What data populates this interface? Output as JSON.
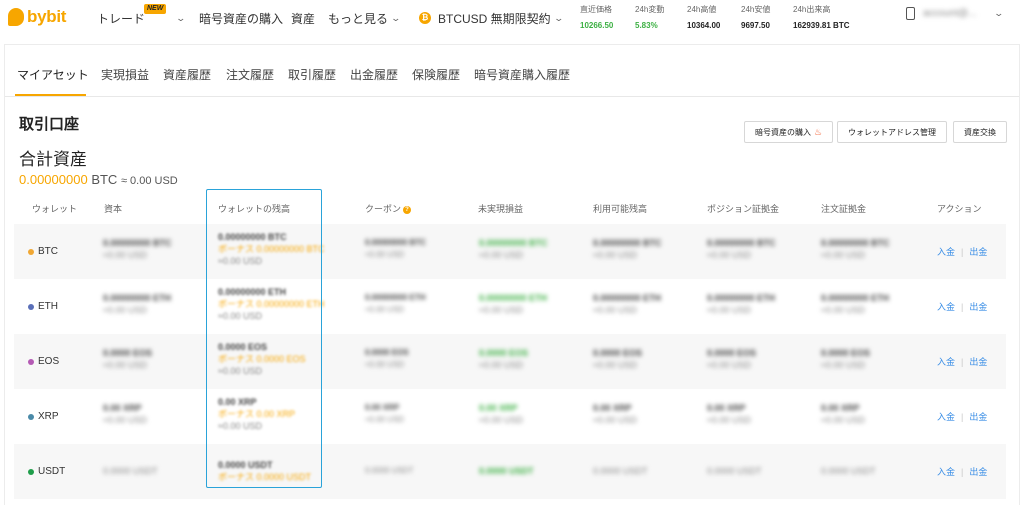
{
  "brand": "bybit",
  "nav": {
    "trade": "トレード",
    "new_badge": "NEW",
    "buy_crypto": "暗号資産の購入",
    "assets": "資産",
    "more": "もっと見る",
    "contract_icon_letter": "₿",
    "contract": "BTCUSD 無期限契約"
  },
  "tickers": [
    {
      "label": "直近価格",
      "value": "10266.50"
    },
    {
      "label": "24h変動",
      "value": "5.83%"
    },
    {
      "label": "24h高値",
      "value": "10364.00"
    },
    {
      "label": "24h安値",
      "value": "9697.50"
    },
    {
      "label": "24h出来高",
      "value": "162939.81 BTC"
    }
  ],
  "account": {
    "masked": "account@..."
  },
  "tabs": [
    "マイアセット",
    "実現損益",
    "資産履歴",
    "注文履歴",
    "取引履歴",
    "出金履歴",
    "保険履歴",
    "暗号資産購入履歴"
  ],
  "section": {
    "title": "取引口座",
    "total_label": "合計資産",
    "total_btc": "0.00000000",
    "total_unit": "BTC",
    "total_usd": "≈ 0.00 USD"
  },
  "buttons": {
    "buy": "暗号資産の購入",
    "wallet_address": "ウォレットアドレス管理",
    "exchange": "資産交換"
  },
  "columns": [
    "ウォレット",
    "資本",
    "ウォレットの残高",
    "クーポン",
    "未実現損益",
    "利用可能残高",
    "ポジション証拠金",
    "注文証拠金",
    "アクション"
  ],
  "actions": {
    "deposit": "入金",
    "withdraw": "出金"
  },
  "colors": {
    "accent": "#f7a600",
    "link": "#3a8ee6",
    "profit": "#3cb043",
    "highlight": "#2aa3d9"
  },
  "rows": [
    {
      "coin": "BTC",
      "dot_color": "#f0a733",
      "equity": "0.00000000 BTC",
      "equity_usd": "≈0.00 USD",
      "wallet": "0.00000000 BTC",
      "wallet_bonus": "ボーナス 0.00000000 BTC",
      "wallet_usd": "≈0.00 USD",
      "coupon": "0.00000000 BTC",
      "coupon_usd": "≈0.00 USD",
      "upnl": "0.00000000 BTC",
      "upnl_usd": "≈0.00 USD",
      "avail": "0.00000000 BTC",
      "avail_usd": "≈0.00 USD",
      "pos": "0.00000000 BTC",
      "pos_usd": "≈0.00 USD",
      "order": "0.00000000 BTC",
      "order_usd": "≈0.00 USD"
    },
    {
      "coin": "ETH",
      "dot_color": "#5a6fb8",
      "equity": "0.00000000 ETH",
      "equity_usd": "≈0.00 USD",
      "wallet": "0.00000000 ETH",
      "wallet_bonus": "ボーナス 0.00000000 ETH",
      "wallet_usd": "≈0.00 USD",
      "coupon": "0.00000000 ETH",
      "coupon_usd": "≈0.00 USD",
      "upnl": "0.00000000 ETH",
      "upnl_usd": "≈0.00 USD",
      "avail": "0.00000000 ETH",
      "avail_usd": "≈0.00 USD",
      "pos": "0.00000000 ETH",
      "pos_usd": "≈0.00 USD",
      "order": "0.00000000 ETH",
      "order_usd": "≈0.00 USD"
    },
    {
      "coin": "EOS",
      "dot_color": "#b45ab4",
      "equity": "0.0000 EOS",
      "equity_usd": "≈0.00 USD",
      "wallet": "0.0000 EOS",
      "wallet_bonus": "ボーナス 0.0000 EOS",
      "wallet_usd": "≈0.00 USD",
      "coupon": "0.0000 EOS",
      "coupon_usd": "≈0.00 USD",
      "upnl": "0.0000 EOS",
      "upnl_usd": "≈0.00 USD",
      "avail": "0.0000 EOS",
      "avail_usd": "≈0.00 USD",
      "pos": "0.0000 EOS",
      "pos_usd": "≈0.00 USD",
      "order": "0.0000 EOS",
      "order_usd": "≈0.00 USD"
    },
    {
      "coin": "XRP",
      "dot_color": "#4a8aa8",
      "equity": "0.00 XRP",
      "equity_usd": "≈0.00 USD",
      "wallet": "0.00 XRP",
      "wallet_bonus": "ボーナス 0.00 XRP",
      "wallet_usd": "≈0.00 USD",
      "coupon": "0.00 XRP",
      "coupon_usd": "≈0.00 USD",
      "upnl": "0.00 XRP",
      "upnl_usd": "≈0.00 USD",
      "avail": "0.00 XRP",
      "avail_usd": "≈0.00 USD",
      "pos": "0.00 XRP",
      "pos_usd": "≈0.00 USD",
      "order": "0.00 XRP",
      "order_usd": "≈0.00 USD"
    },
    {
      "coin": "USDT",
      "dot_color": "#1f9d4a",
      "equity": "0.0000 USDT",
      "wallet": "0.0000 USDT",
      "wallet_bonus": "ボーナス 0.0000 USDT",
      "coupon": "0.0000 USDT",
      "upnl": "0.0000 USDT",
      "avail": "0.0000 USDT",
      "pos": "0.0000 USDT",
      "order": "0.0000 USDT"
    }
  ]
}
